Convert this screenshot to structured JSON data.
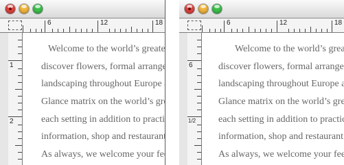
{
  "windows": [
    {
      "hruler_labels": [
        "6",
        "12",
        "18"
      ],
      "vruler_labels": [
        "1",
        "2"
      ],
      "lines": [
        "Welcome to the world’s greatest liv",
        "discover flowers, formal arrangemen",
        "landscaping throughout Europe and t",
        "Glance matrix on the world’s greatest",
        "each setting in addition to practical in",
        "information, shop and restaurant not",
        "As always, we welcome your feedback"
      ]
    },
    {
      "hruler_labels": [
        "6",
        "12",
        "18"
      ],
      "vruler_labels": [
        "6",
        "1/2"
      ],
      "lines": [
        "Welcome to the world’s greatest liv",
        "discover flowers, formal arrangement",
        "landscaping throughout Europe and t",
        "Glance matrix on the world’s greatest",
        "each setting in addition to practical in",
        "information, shop and restaurant not",
        "As always, we welcome your feedbac"
      ]
    }
  ],
  "colors": {
    "close": "#e0443e",
    "minimize": "#f1b53c",
    "zoom": "#3dbf4c"
  }
}
